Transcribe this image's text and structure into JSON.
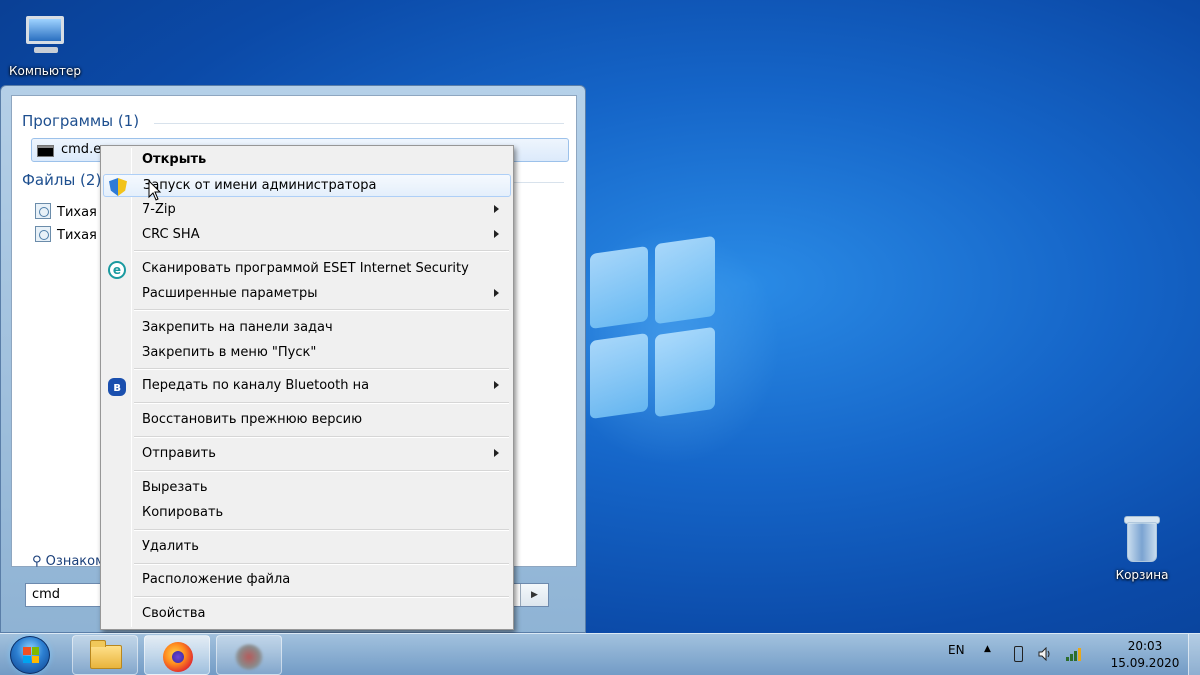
{
  "desktop": {
    "icons": {
      "computer": "Компьютер",
      "recycle_bin": "Корзина"
    }
  },
  "start_menu": {
    "programs_header": "Программы (1)",
    "program_item": "cmd.exe",
    "files_header": "Файлы (2)",
    "file_items": [
      "Тихая у",
      "Тихая у"
    ],
    "more_results": "Ознаком",
    "search_value": "cmd"
  },
  "context_menu": {
    "items": [
      {
        "label": "Открыть",
        "bold": true
      },
      {
        "label": "Запуск от имени администратора",
        "icon": "uac-shield-icon"
      },
      {
        "label": "7-Zip",
        "submenu": true
      },
      {
        "label": "CRC SHA",
        "submenu": true
      },
      {
        "label": "Сканировать программой ESET Internet Security",
        "icon": "eset-icon"
      },
      {
        "label": "Расширенные параметры",
        "submenu": true
      },
      {
        "label": "Закрепить на панели задач"
      },
      {
        "label": "Закрепить в меню \"Пуск\""
      },
      {
        "label": "Передать по каналу Bluetooth на",
        "icon": "bluetooth-icon",
        "submenu": true
      },
      {
        "label": "Восстановить прежнюю версию"
      },
      {
        "label": "Отправить",
        "submenu": true
      },
      {
        "label": "Вырезать"
      },
      {
        "label": "Копировать"
      },
      {
        "label": "Удалить"
      },
      {
        "label": "Расположение файла"
      },
      {
        "label": "Свойства"
      }
    ],
    "icon_glyphs": {
      "eset": "e",
      "bluetooth": "ʙ"
    }
  },
  "taskbar": {
    "apps": [
      "explorer-icon",
      "firefox-icon",
      "app-icon"
    ],
    "language": "EN",
    "time": "20:03",
    "date": "15.09.2020"
  }
}
